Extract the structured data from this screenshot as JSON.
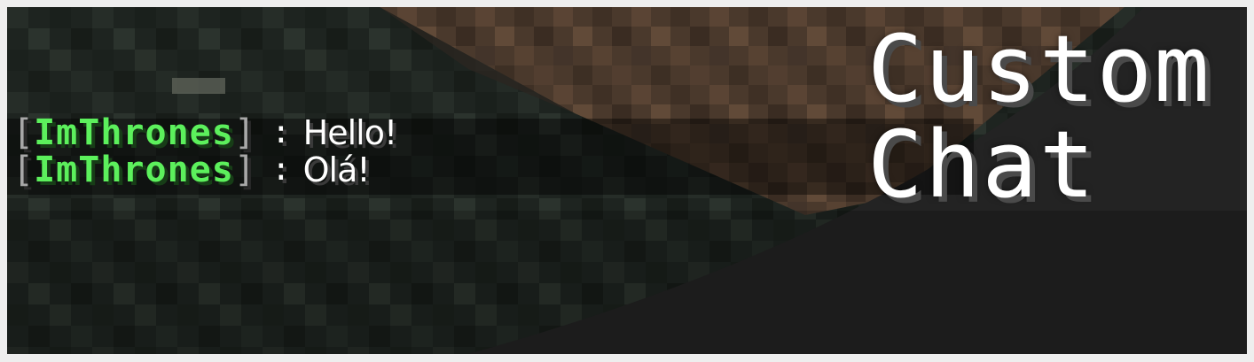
{
  "banner": {
    "title_line1": "Custom",
    "title_line2": "Chat"
  },
  "chat": {
    "lines": [
      {
        "bracket_open": "[",
        "player": "ImThrones",
        "bracket_close": "]",
        "separator": ":",
        "message": "Hello!"
      },
      {
        "bracket_open": "[",
        "player": "ImThrones",
        "bracket_close": "]",
        "separator": ":",
        "message": "Olá!"
      }
    ]
  },
  "colors": {
    "player_name": "#5cf05c",
    "bracket": "#a8a8a8",
    "message": "#ffffff",
    "title": "#ffffff",
    "dark_panel": "#232323"
  }
}
